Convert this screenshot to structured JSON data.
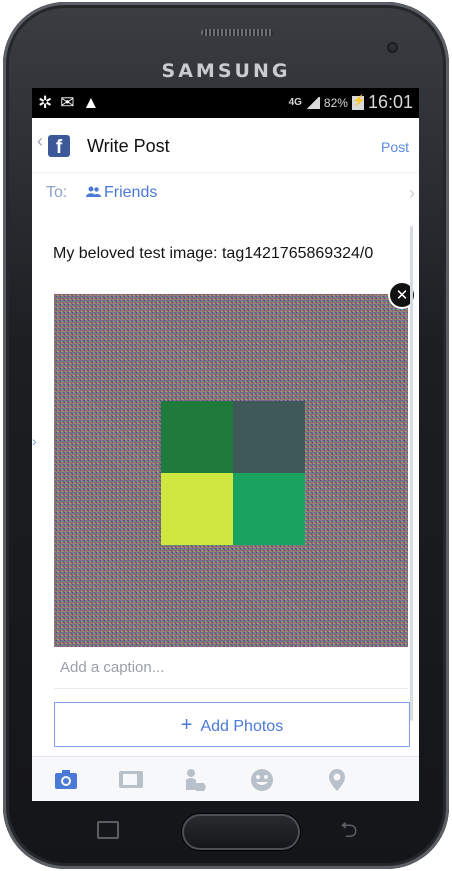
{
  "device": {
    "brand": "SAMSUNG"
  },
  "status_bar": {
    "network": "4G",
    "battery": "82%",
    "time": "16:01"
  },
  "app_bar": {
    "title": "Write Post",
    "post_label": "Post"
  },
  "audience": {
    "to_label": "To:",
    "value": "Friends"
  },
  "post": {
    "message": "My beloved test image: tag1421765869324/0"
  },
  "image": {
    "tiles": [
      {
        "color": "#1f7a3b"
      },
      {
        "color": "#3f5958"
      },
      {
        "color": "#cfe83f"
      },
      {
        "color": "#1aa35e"
      }
    ]
  },
  "caption": {
    "placeholder": "Add a caption..."
  },
  "add_photos": {
    "label": "Add Photos"
  },
  "toolbar": {
    "icons": [
      "camera-icon",
      "video-icon",
      "tag-people-icon",
      "feeling-icon",
      "location-icon"
    ],
    "active_color": "#4a79d6",
    "inactive_color": "#b8c0ca"
  }
}
